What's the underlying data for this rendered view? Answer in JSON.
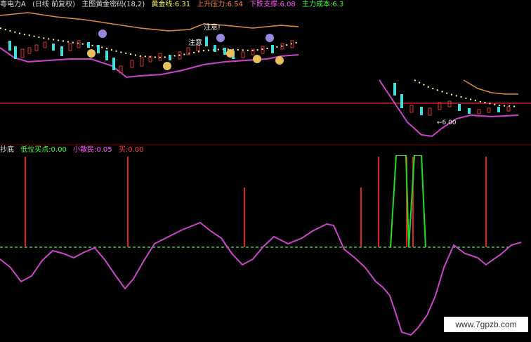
{
  "header": {
    "stock_name": "粤电力A",
    "period": "(日线 前复权)",
    "indicator": "主图黄金密码(18,2)",
    "gold_line": "黄金线:6.31",
    "resist": "上升压力:6.54",
    "support": "下跌支撑:6.08",
    "cost": "主力成本:6.3"
  },
  "sub_header": {
    "name": "抄底",
    "low_buy": "低位买点:0.00",
    "retail": "小散民:0.05",
    "buy": "买:0.00"
  },
  "annotations": {
    "caution_1": "注意!",
    "caution_2": "注意",
    "low_price": "←6.00"
  },
  "watermark": "www.7gpzb.com",
  "colors": {
    "background": "#000000",
    "red_line": "#cc2222",
    "orange_band": "#e08a3a",
    "magenta_band": "#cc44cc",
    "dot_line": "#ffff99",
    "green": "#22dd22",
    "cyan_candle": "#44dddd"
  }
}
